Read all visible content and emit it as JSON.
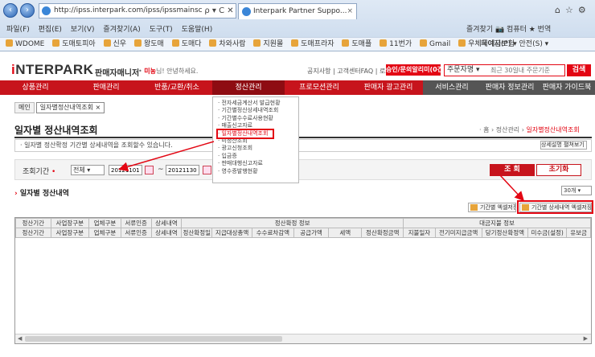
{
  "browser": {
    "address": "http://ipss.interpark.com/ipss/ipssmainscr.do?_method=ini",
    "address_ctrls": "ρ ▾ C ✕",
    "tab_title": "Interpark Partner Suppo...",
    "menu": [
      "파일(F)",
      "편집(E)",
      "보기(V)",
      "즐겨찾기(A)",
      "도구(T)",
      "도움말(H)"
    ],
    "menu_right": "즐겨찾기  📷 컴퓨터  ★ 번역",
    "favorites": [
      "WDOME",
      "도매토피아",
      "신우",
      "왕도매",
      "도매다",
      "차와사람",
      "지원몰",
      "도매프라자",
      "도매플",
      "11번가",
      "Gmail",
      "우체국예금보험"
    ],
    "favbar_right": "페이지(P) ▾  안전(S) ▾"
  },
  "header": {
    "logo_i": "i",
    "logo_rest": "NTERPARK",
    "logo_sub": "판매자매니저",
    "welcome_prefix": "미농",
    "welcome_suffix": "님! 안녕하세요.",
    "top_links": "공지사항 | 고객센터FAQ | 로그아웃",
    "alarm_button": "승인/문의알리미(0건)",
    "search_type": "주문자명",
    "search_placeholder": "최근 30일내 주문기준",
    "search_button": "검색"
  },
  "gnb": [
    {
      "label": "상품관리",
      "state": "normal"
    },
    {
      "label": "판매관리",
      "state": "normal"
    },
    {
      "label": "반품/교환/취소",
      "state": "normal"
    },
    {
      "label": "정산관리",
      "state": "active"
    },
    {
      "label": "프로모션관리",
      "state": "normal"
    },
    {
      "label": "판매자 광고관리",
      "state": "normal"
    },
    {
      "label": "서비스관리",
      "state": "dark"
    },
    {
      "label": "판매자 정보관리",
      "state": "dark"
    },
    {
      "label": "판매자 가이드북",
      "state": "dark"
    }
  ],
  "dropdown": [
    {
      "label": "전자세금계산서 발급현황",
      "selected": false
    },
    {
      "label": "기간별정산상세내역조회",
      "selected": false
    },
    {
      "label": "기간별수수료사용현황",
      "selected": false
    },
    {
      "label": "매출신고자료",
      "selected": false
    },
    {
      "label": "일자별정산내역조회",
      "selected": true
    },
    {
      "label": "미정산조회",
      "selected": false
    },
    {
      "label": "광고신청조회",
      "selected": false
    },
    {
      "label": "입금증",
      "selected": false
    },
    {
      "label": "판매대행신고자료",
      "selected": false
    },
    {
      "label": "영수증발행현황",
      "selected": false
    }
  ],
  "page_tabs": [
    {
      "label": "메인",
      "active": false
    },
    {
      "label": "일자별정산내역조회 ×",
      "active": true
    }
  ],
  "page": {
    "title": "일자별 정산내역조회",
    "breadcrumb_prefix": "· 홈 › 정산관리 ›",
    "breadcrumb_current": "일자별정산내역조회",
    "description": "· 일자별 정산확정 기간별 상세내역을 조회할수 있습니다.",
    "detail_toggle": "상세설명 펼쳐보기 ▾"
  },
  "search": {
    "period_label": "조회기간",
    "required_mark": "•",
    "period_select": "전체",
    "date_from": "20121101",
    "tilde": "~",
    "date_to": "20121130",
    "query_button": "조 회",
    "reset_button": "초기화"
  },
  "results": {
    "section_title": "일자별 정산내역",
    "page_size": "30개",
    "excel_period": "기간별 엑셀저장",
    "excel_detail": "기간별 상세내역 엑셀저장"
  },
  "grid": {
    "group_headers": [
      "정산확정 정보",
      "대금지불 정보"
    ],
    "top_headers": [
      "정산기간",
      "사업장구분",
      "업체구분",
      "서류인증",
      "상세내역"
    ],
    "sub_headers": [
      "정산기간",
      "사업장구분",
      "업체구분",
      "서류인증",
      "상세내역",
      "정산확정일",
      "지급대상총액",
      "수수료차감액",
      "공급가액",
      "세액",
      "정산확정금액",
      "지불일자",
      "전기미지급금액",
      "당기정산확정액",
      "미수금(설정)",
      "유보금"
    ]
  },
  "colors": {
    "brand_red": "#c7141c",
    "highlight_red": "#e30613",
    "gnb_active": "#8e0c12"
  }
}
